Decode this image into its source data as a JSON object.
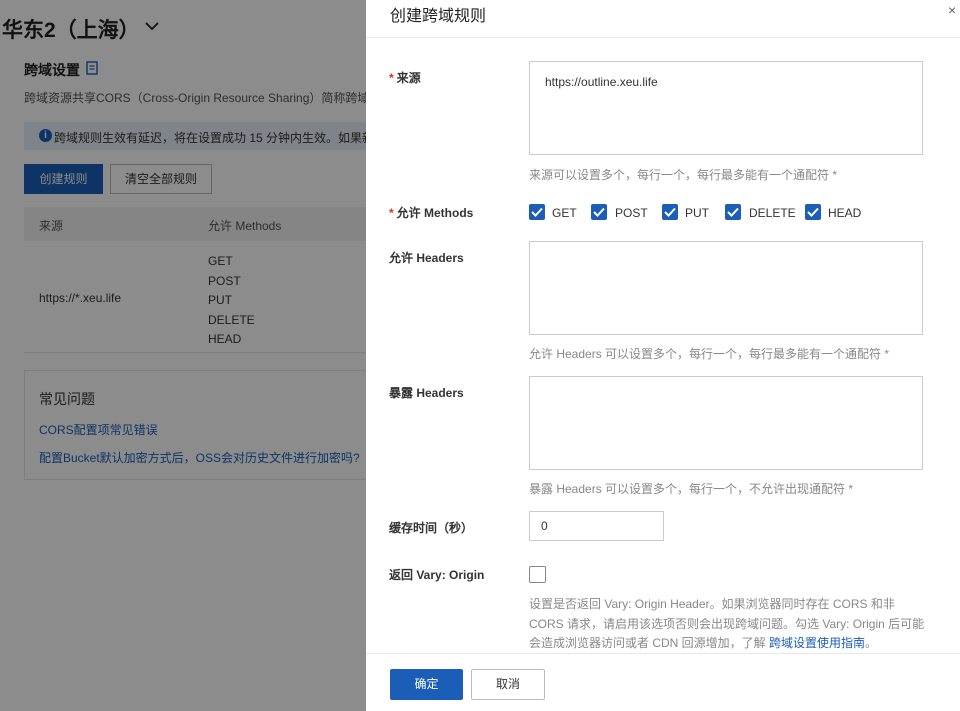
{
  "background": {
    "region": "华东2（上海）",
    "section_title": "跨域设置",
    "section_desc": "跨域资源共享CORS（Cross-Origin Resource Sharing）简称跨域访问",
    "notice": "跨域规则生效有延迟，将在设置成功 15 分钟内生效。如果新",
    "notice_icon": "i",
    "create_rule_btn": "创建规则",
    "clear_all_btn": "清空全部规则",
    "table": {
      "headers": [
        "来源",
        "允许 Methods"
      ],
      "rows": [
        {
          "origin": "https://*.xeu.life",
          "methods": [
            "GET",
            "POST",
            "PUT",
            "DELETE",
            "HEAD"
          ]
        }
      ]
    },
    "faq": {
      "title": "常见问题",
      "links": [
        "CORS配置项常见错误",
        "配置Bucket默认加密方式后，OSS会对历史文件进行加密吗?"
      ]
    }
  },
  "drawer": {
    "title": "创建跨域规则",
    "close_icon": "×",
    "origin": {
      "required_mark": "*",
      "label": "来源",
      "value": "https://outline.xeu.life",
      "help": "来源可以设置多个，每行一个，每行最多能有一个通配符 *"
    },
    "methods": {
      "required_mark": "*",
      "label": "允许 Methods",
      "options": [
        {
          "label": "GET",
          "checked": true
        },
        {
          "label": "POST",
          "checked": true
        },
        {
          "label": "PUT",
          "checked": true
        },
        {
          "label": "DELETE",
          "checked": true
        },
        {
          "label": "HEAD",
          "checked": true
        }
      ]
    },
    "allow_headers": {
      "label": "允许 Headers",
      "value": "",
      "help": "允许 Headers 可以设置多个，每行一个，每行最多能有一个通配符 *"
    },
    "expose_headers": {
      "label": "暴露 Headers",
      "value": "",
      "help": "暴露 Headers 可以设置多个，每行一个，不允许出现通配符 *"
    },
    "cache_time": {
      "label": "缓存时间（秒）",
      "value": "0"
    },
    "vary_origin": {
      "label": "返回 Vary: Origin",
      "checked": false,
      "desc": "设置是否返回 Vary: Origin Header。如果浏览器同时存在 CORS 和非 CORS 请求，请启用该选项否则会出现跨域问题。勾选 Vary: Origin 后可能会造成浏览器访问或者 CDN 回源增加，了解 ",
      "link": "跨域设置使用指南",
      "desc_end": "。"
    },
    "ok_btn": "确定",
    "cancel_btn": "取消"
  },
  "colors": {
    "primary": "#1a5eb8",
    "required": "#d93026",
    "overlay": "rgba(0,0,0,0.45)"
  }
}
